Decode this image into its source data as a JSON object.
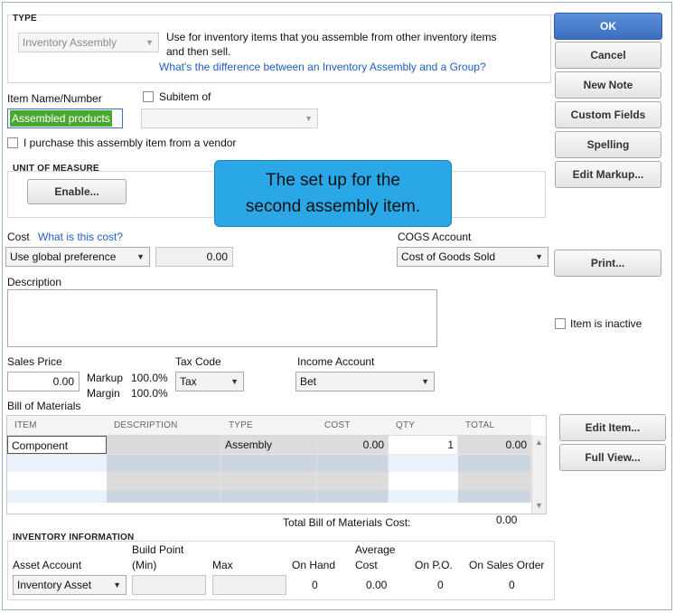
{
  "type_section": {
    "title": "TYPE",
    "type_value": "Inventory Assembly",
    "description": "Use for inventory items that you assemble from other inventory items",
    "description_line2": "and then sell.",
    "difference_link": "What's the difference between an Inventory Assembly and a Group?"
  },
  "item": {
    "name_label": "Item Name/Number",
    "name_value": "Assembled products",
    "subitem_label": "Subitem of",
    "vendor_checkbox_label": "I purchase this assembly item from a vendor"
  },
  "unit_of_measure": {
    "title": "UNIT OF MEASURE",
    "enable_label": "Enable..."
  },
  "callout": {
    "line1": "The set up for the",
    "line2": "second assembly item."
  },
  "cost": {
    "label": "Cost",
    "help_link": "What is this cost?",
    "preference": "Use global preference",
    "value": "0.00",
    "cogs_label": "COGS Account",
    "cogs_value": "Cost of Goods Sold"
  },
  "description": {
    "label": "Description",
    "value": ""
  },
  "sales": {
    "price_label": "Sales Price",
    "price_value": "0.00",
    "markup_label": "Markup",
    "markup_value": "100.0%",
    "margin_label": "Margin",
    "margin_value": "100.0%",
    "tax_label": "Tax Code",
    "tax_value": "Tax",
    "income_label": "Income Account",
    "income_value": "Bet"
  },
  "bom": {
    "label": "Bill of Materials",
    "columns": [
      "ITEM",
      "DESCRIPTION",
      "TYPE",
      "COST",
      "QTY",
      "TOTAL"
    ],
    "rows": [
      {
        "item": "Component",
        "description": "",
        "type": "Assembly",
        "cost": "0.00",
        "qty": "1",
        "total": "0.00"
      }
    ],
    "total_label": "Total Bill of Materials Cost:",
    "total_value": "0.00"
  },
  "inventory": {
    "title": "INVENTORY INFORMATION",
    "asset_label": "Asset Account",
    "asset_value": "Inventory Asset",
    "build_point_label1": "Build Point",
    "build_point_label2": "(Min)",
    "max_label": "Max",
    "on_hand_label": "On Hand",
    "on_hand_value": "0",
    "avg_cost_label1": "Average",
    "avg_cost_label2": "Cost",
    "avg_cost_value": "0.00",
    "on_po_label": "On P.O.",
    "on_po_value": "0",
    "on_so_label": "On Sales Order",
    "on_so_value": "0"
  },
  "buttons": {
    "ok": "OK",
    "cancel": "Cancel",
    "new_note": "New Note",
    "custom_fields": "Custom Fields",
    "spelling": "Spelling",
    "edit_markup": "Edit Markup...",
    "print": "Print...",
    "edit_item": "Edit Item...",
    "full_view": "Full View..."
  },
  "inactive_label": "Item is inactive",
  "colors": {
    "accent_button": "#3c6fc1",
    "callout": "#29a7e6",
    "name_highlight": "#4aa82f"
  }
}
